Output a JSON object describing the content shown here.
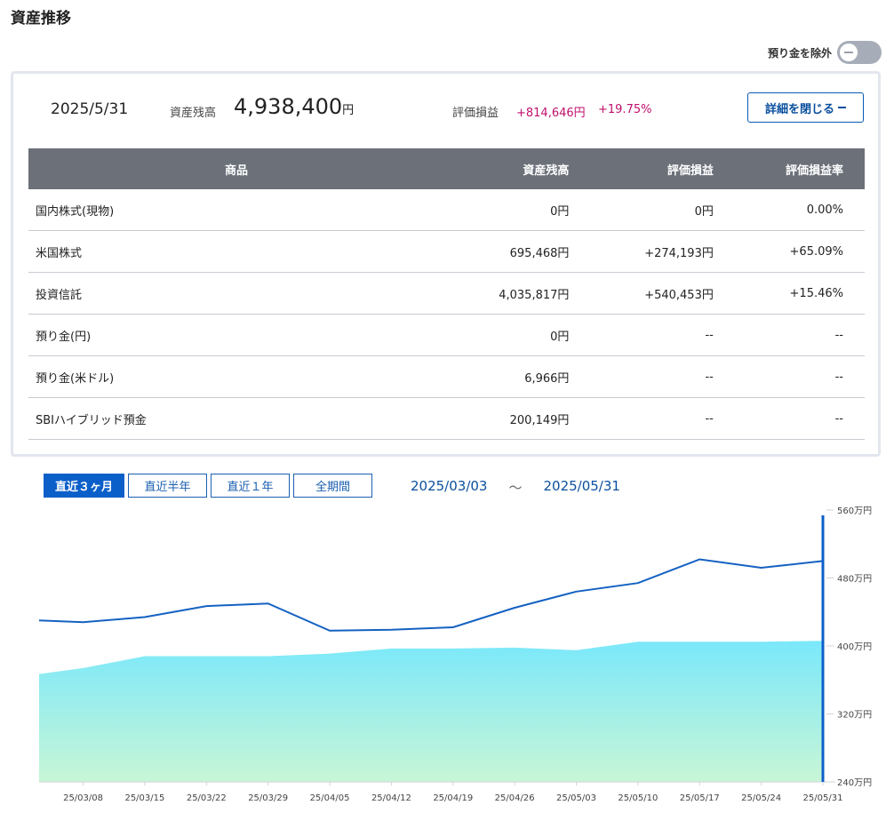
{
  "page": {
    "title": "資産推移"
  },
  "toggle": {
    "label": "預り金を除外",
    "on": false
  },
  "summary": {
    "date": "2025/5/31",
    "balance_label": "資産残高",
    "balance_value": "4,938,400",
    "balance_unit": "円",
    "pl_label": "評価損益",
    "pl_amount": "+814,646円",
    "pl_rate": "+19.75%",
    "detail_button": "詳細を閉じる"
  },
  "table": {
    "headers": [
      "商品",
      "資産残高",
      "評価損益",
      "評価損益率"
    ],
    "rows": [
      {
        "name": "国内株式(現物)",
        "balance": "0円",
        "pl": "0円",
        "rate": "0.00%",
        "positive": false
      },
      {
        "name": "米国株式",
        "balance": "695,468円",
        "pl": "+274,193円",
        "rate": "+65.09%",
        "positive": true
      },
      {
        "name": "投資信託",
        "balance": "4,035,817円",
        "pl": "+540,453円",
        "rate": "+15.46%",
        "positive": true
      },
      {
        "name": "預り金(円)",
        "balance": "0円",
        "pl": "--",
        "rate": "--",
        "positive": false
      },
      {
        "name": "預り金(米ドル)",
        "balance": "6,966円",
        "pl": "--",
        "rate": "--",
        "positive": false
      },
      {
        "name": "SBIハイブリッド預金",
        "balance": "200,149円",
        "pl": "--",
        "rate": "--",
        "positive": false
      }
    ]
  },
  "range": {
    "tabs": [
      "直近３ヶ月",
      "直近半年",
      "直近１年",
      "全期間"
    ],
    "active": 0,
    "start": "2025/03/03",
    "separator": "～",
    "end": "2025/05/31"
  },
  "colors": {
    "line": "#1461c2",
    "area_top": "#7ae8fa",
    "area_bottom": "#c8f6d6",
    "accent": "#0b5fc9",
    "positive": "#c0106e"
  },
  "chart_data": {
    "type": "area",
    "x_tick_labels": [
      "25/03/08",
      "25/03/15",
      "25/03/22",
      "25/03/29",
      "25/04/05",
      "25/04/12",
      "25/04/19",
      "25/04/26",
      "25/05/03",
      "25/05/10",
      "25/05/17",
      "25/05/24",
      "25/05/31"
    ],
    "y_tick_labels": [
      "560万円",
      "480万円",
      "400万円",
      "320万円",
      "240万円"
    ],
    "ylim": [
      240,
      560
    ],
    "y_ticks": [
      560,
      480,
      400,
      320,
      240
    ],
    "dates": [
      "2025/03/03",
      "2025/03/08",
      "2025/03/15",
      "2025/03/22",
      "2025/03/29",
      "2025/04/05",
      "2025/04/12",
      "2025/04/19",
      "2025/04/26",
      "2025/05/03",
      "2025/05/10",
      "2025/05/17",
      "2025/05/24",
      "2025/05/31"
    ],
    "series": [
      {
        "name": "",
        "kind": "line",
        "values": [
          430,
          428,
          434,
          447,
          450,
          418,
          419,
          422,
          445,
          464,
          474,
          502,
          492,
          500
        ]
      },
      {
        "name": "",
        "kind": "area",
        "values": [
          367,
          374,
          388,
          388,
          388,
          391,
          397,
          397,
          398,
          395,
          405,
          405,
          405,
          406
        ]
      }
    ],
    "grid": false,
    "legend": "none"
  }
}
